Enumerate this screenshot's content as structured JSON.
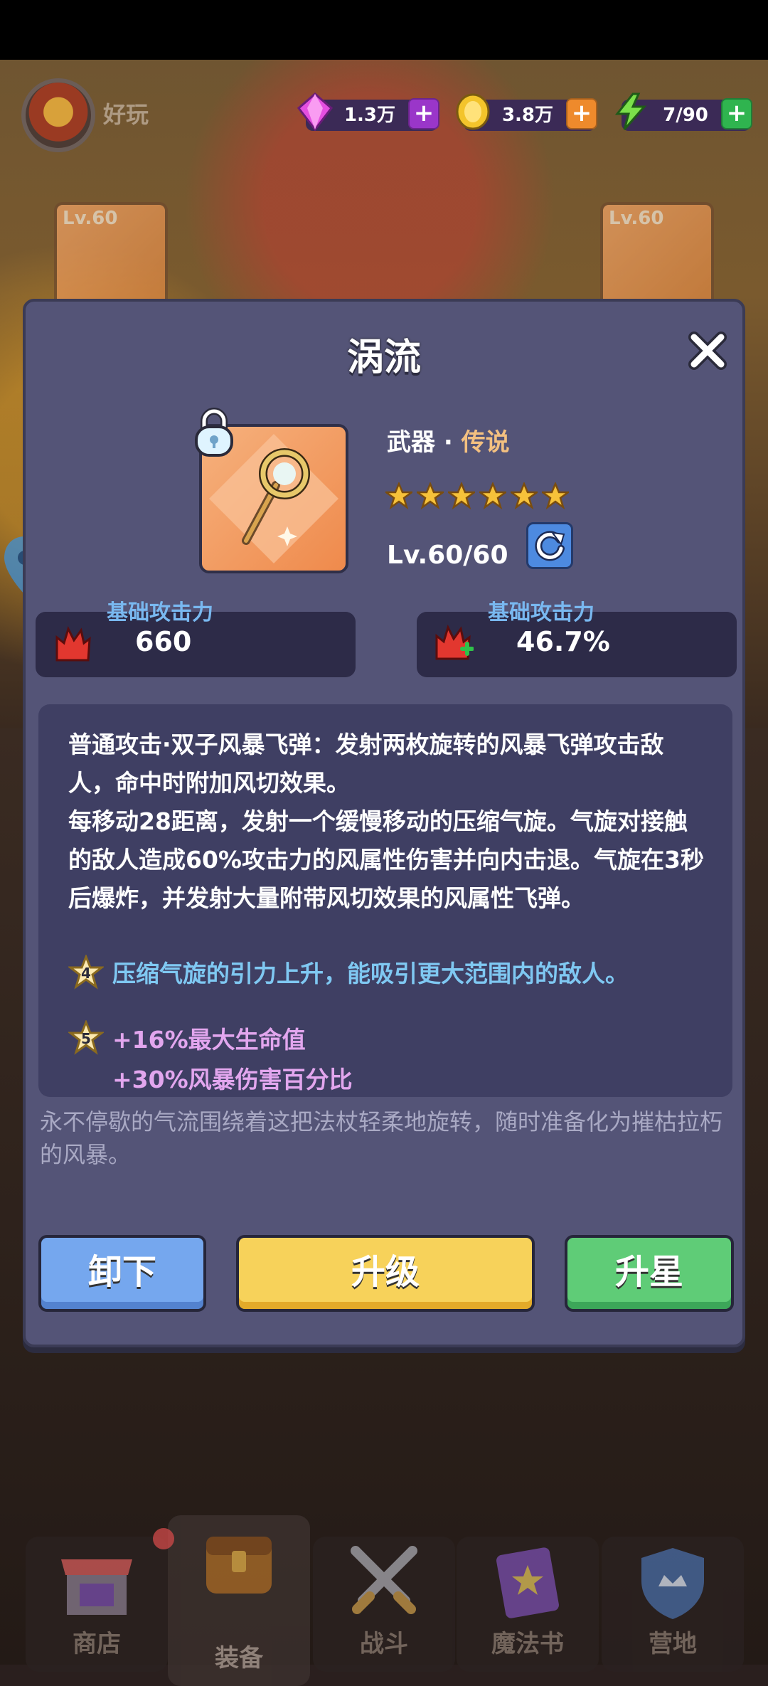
{
  "header": {
    "nickname": "好玩",
    "resources": [
      {
        "name": "gem",
        "icon": "gem-icon",
        "value": "1.3万",
        "color": "#b03bd6"
      },
      {
        "name": "gold",
        "icon": "coin-icon",
        "value": "3.8万",
        "color": "#f08a2e"
      },
      {
        "name": "energy",
        "icon": "lightning-icon",
        "value": "7/90",
        "color": "#2fb44f"
      }
    ],
    "side_cards": [
      {
        "label": "Lv.60"
      },
      {
        "label": "Lv.60"
      }
    ]
  },
  "modal": {
    "title": "涡流",
    "item": {
      "type": "武器",
      "separator": " · ",
      "rarity": "传说",
      "stars": 6,
      "level": "Lv.60/60"
    },
    "stats": [
      {
        "label": "基础攻击力",
        "value": "660"
      },
      {
        "label": "基础攻击力",
        "value": "46.7%"
      }
    ],
    "description": {
      "line1": "普通攻击·双子风暴飞弹：发射两枚旋转的风暴飞弹攻击敌人，命中时附加风切效果。",
      "line2": "每移动28距离，发射一个缓慢移动的压缩气旋。气旋对接触的敌人造成60%攻击力的风属性伤害并向内击退。气旋在3秒后爆炸，并发射大量附带风切效果的风属性飞弹。",
      "star4_num": "4",
      "star4": "压缩气旋的引力上升，能吸引更大范围内的敌人。",
      "star5_num": "5",
      "star5_a": "+16%最大生命值",
      "star5_b": "+30%风暴伤害百分比"
    },
    "flavor": "永不停歇的气流围绕着这把法杖轻柔地旋转，随时准备化为摧枯拉朽的风暴。",
    "buttons": {
      "unequip": "卸下",
      "upgrade": "升级",
      "star_up": "升星"
    }
  },
  "nav": {
    "items": [
      {
        "label": "商店",
        "icon": "shop-icon"
      },
      {
        "label": "装备",
        "icon": "chest-icon",
        "active": true
      },
      {
        "label": "战斗",
        "icon": "crossed-swords-icon"
      },
      {
        "label": "魔法书",
        "icon": "spellbook-icon"
      },
      {
        "label": "营地",
        "icon": "shield-icon"
      }
    ]
  }
}
